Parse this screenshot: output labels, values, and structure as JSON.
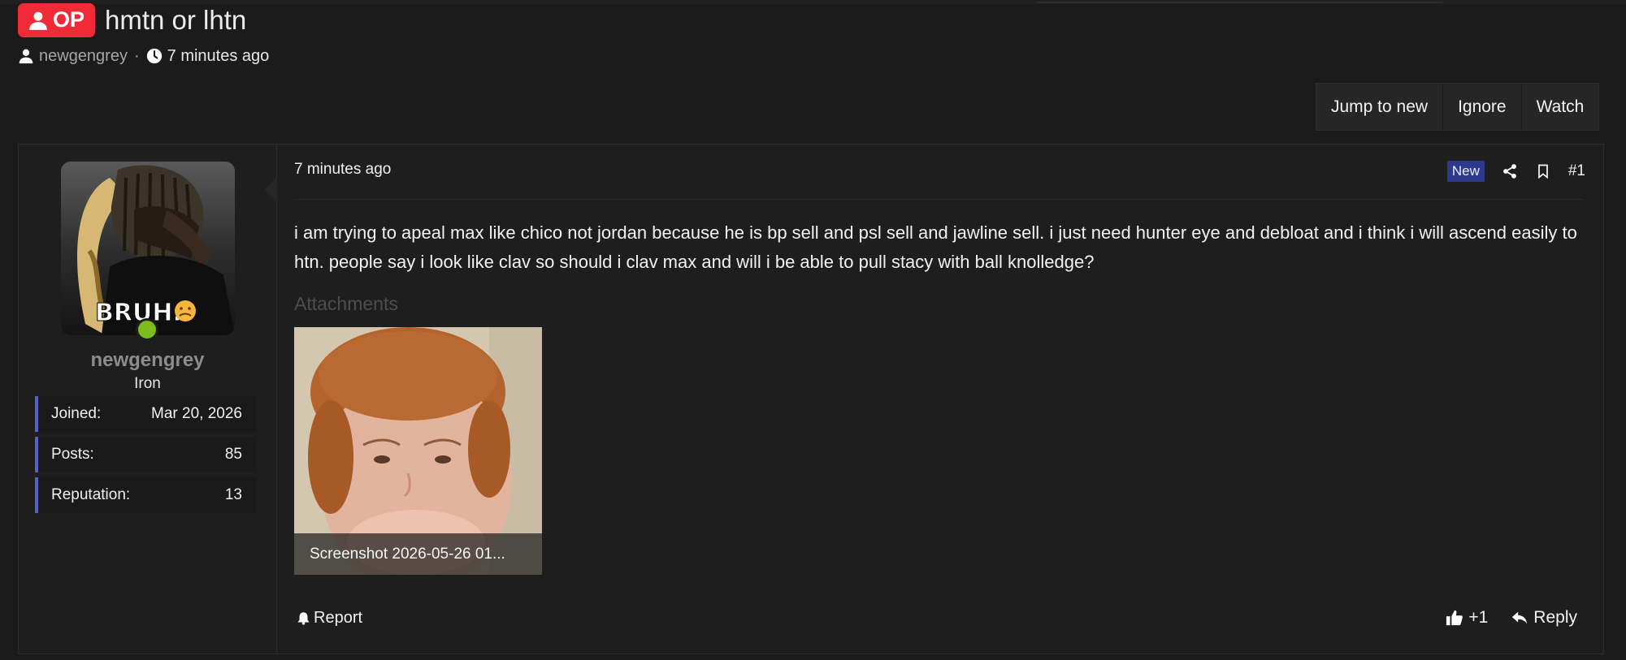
{
  "thread": {
    "badge": "OP",
    "title": "hmtn or lhtn",
    "author": "newgengrey",
    "separator": "·",
    "time": "7 minutes ago"
  },
  "actions": [
    "Jump to new",
    "Ignore",
    "Watch"
  ],
  "user": {
    "name": "newgengrey",
    "rank": "Iron",
    "avatar_text": "BRUH.",
    "avatar_emoji": "😩",
    "stats": [
      {
        "label": "Joined:",
        "value": "Mar 20, 2026"
      },
      {
        "label": "Posts:",
        "value": "85"
      },
      {
        "label": "Reputation:",
        "value": "13"
      }
    ]
  },
  "post": {
    "time": "7 minutes ago",
    "new_badge": "New",
    "number": "#1",
    "body": "i am trying to apeal max like chico not jordan because he is bp sell and psl sell and jawline sell. i just need hunter eye and debloat and i think i will ascend easily to htn. people say i look like clav so should i clav max and will i be able to pull stacy with ball knolledge?",
    "attachments_label": "Attachments",
    "attachment_name": "Screenshot 2026-05-26 01...",
    "report": "Report",
    "like_count": "+1",
    "reply": "Reply"
  },
  "colors": {
    "background": "#1b1b1b",
    "op_badge": "#f02a36",
    "stat_accent": "#5a5fc8",
    "new_badge": "#2d3a8c",
    "online": "#7bbd1a"
  }
}
